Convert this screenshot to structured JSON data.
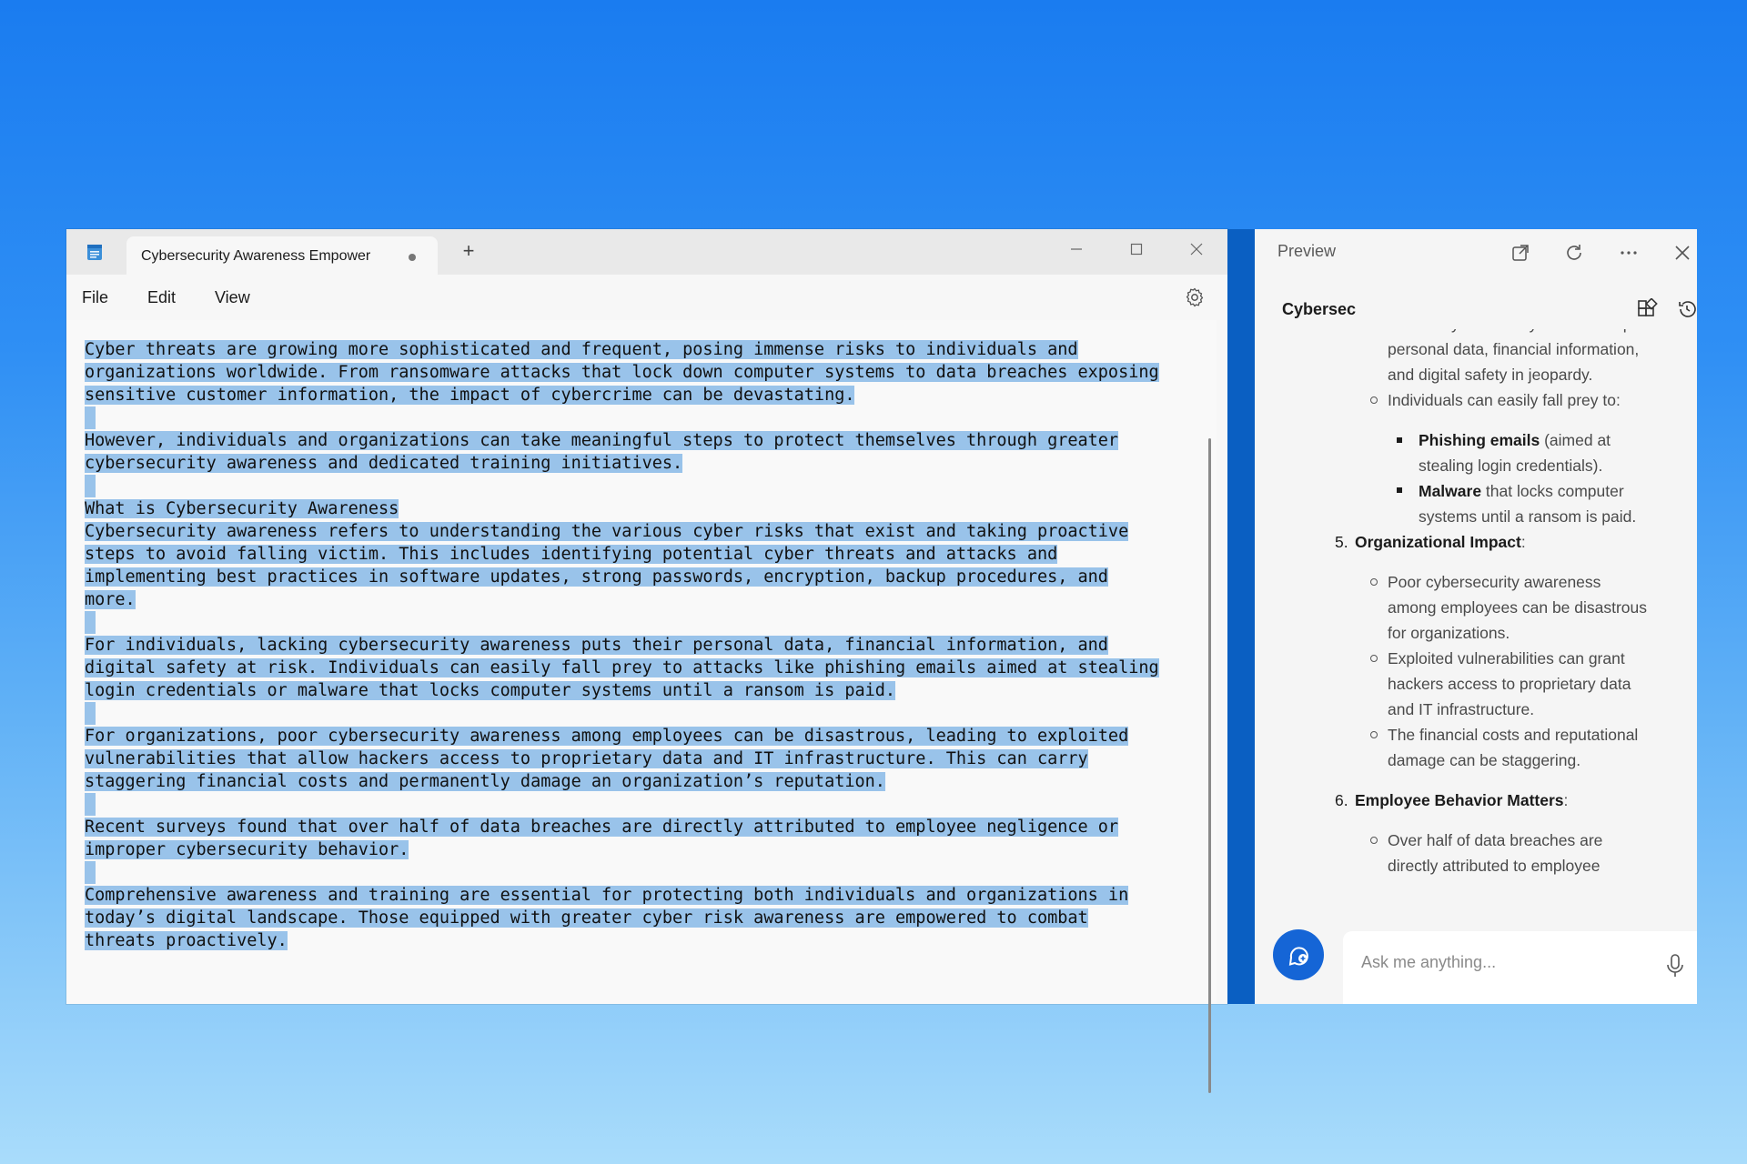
{
  "notepad": {
    "tab_title": "Cybersecurity Awareness Empower",
    "new_tab": "+",
    "menu": [
      "File",
      "Edit",
      "View"
    ],
    "paragraphs": [
      [
        "Cyber threats are growing more sophisticated and frequent, posing immense risks to individuals and",
        "organizations worldwide. From ransomware attacks that lock down computer systems to data breaches exposing",
        "sensitive customer information, the impact of cybercrime can be devastating."
      ],
      [
        "However, individuals and organizations can take meaningful steps to protect themselves through greater",
        "cybersecurity awareness and dedicated training initiatives."
      ],
      [
        "What is Cybersecurity Awareness",
        "Cybersecurity awareness refers to understanding the various cyber risks that exist and taking proactive",
        "steps to avoid falling victim. This includes identifying potential cyber threats and attacks and",
        "implementing best practices in software updates, strong passwords, encryption, backup procedures, and",
        "more."
      ],
      [
        "For individuals, lacking cybersecurity awareness puts their personal data, financial information, and",
        "digital safety at risk. Individuals can easily fall prey to attacks like phishing emails aimed at stealing",
        "login credentials or malware that locks computer systems until a ransom is paid."
      ],
      [
        "For organizations, poor cybersecurity awareness among employees can be disastrous, leading to exploited",
        "vulnerabilities that allow hackers access to proprietary data and IT infrastructure. This can carry",
        "staggering financial costs and permanently damage an organization’s reputation."
      ],
      [
        "Recent surveys found that over half of data breaches are directly attributed to employee negligence or",
        "improper cybersecurity behavior."
      ],
      [
        "Comprehensive awareness and training are essential for protecting both individuals and organizations in",
        "today’s digital landscape. Those equipped with greater cyber risk awareness are empowered to combat",
        "threats proactively."
      ]
    ]
  },
  "preview": {
    "title": "Preview",
    "subtitle": "Cybersec",
    "items": {
      "cut_top": "Lack of cybersecurity awareness puts",
      "b1_line2": "personal data, financial information,",
      "b1_line3": "and digital safety in jeopardy.",
      "b2": "Individuals can easily fall prey to:",
      "s1_bold": "Phishing emails",
      "s1_rest": " (aimed at",
      "s1_line2": "stealing login credentials).",
      "s2_bold": "Malware",
      "s2_rest": " that locks computer",
      "s2_line2": "systems until a ransom is paid.",
      "h5_num": "5.",
      "h5": "Organizational Impact",
      "h5_colon": ":",
      "o1_l1": "Poor cybersecurity awareness",
      "o1_l2": "among employees can be disastrous",
      "o1_l3": "for organizations.",
      "o2_l1": "Exploited vulnerabilities can grant",
      "o2_l2": "hackers access to proprietary data",
      "o2_l3": "and IT infrastructure.",
      "o3_l1": "The financial costs and reputational",
      "o3_l2": "damage can be staggering.",
      "h6_num": "6.",
      "h6": "Employee Behavior Matters",
      "h6_colon": ":",
      "e1_l1": "Over half of data breaches are",
      "e1_l2": "directly attributed to employee"
    },
    "input_placeholder": "Ask me anything..."
  }
}
